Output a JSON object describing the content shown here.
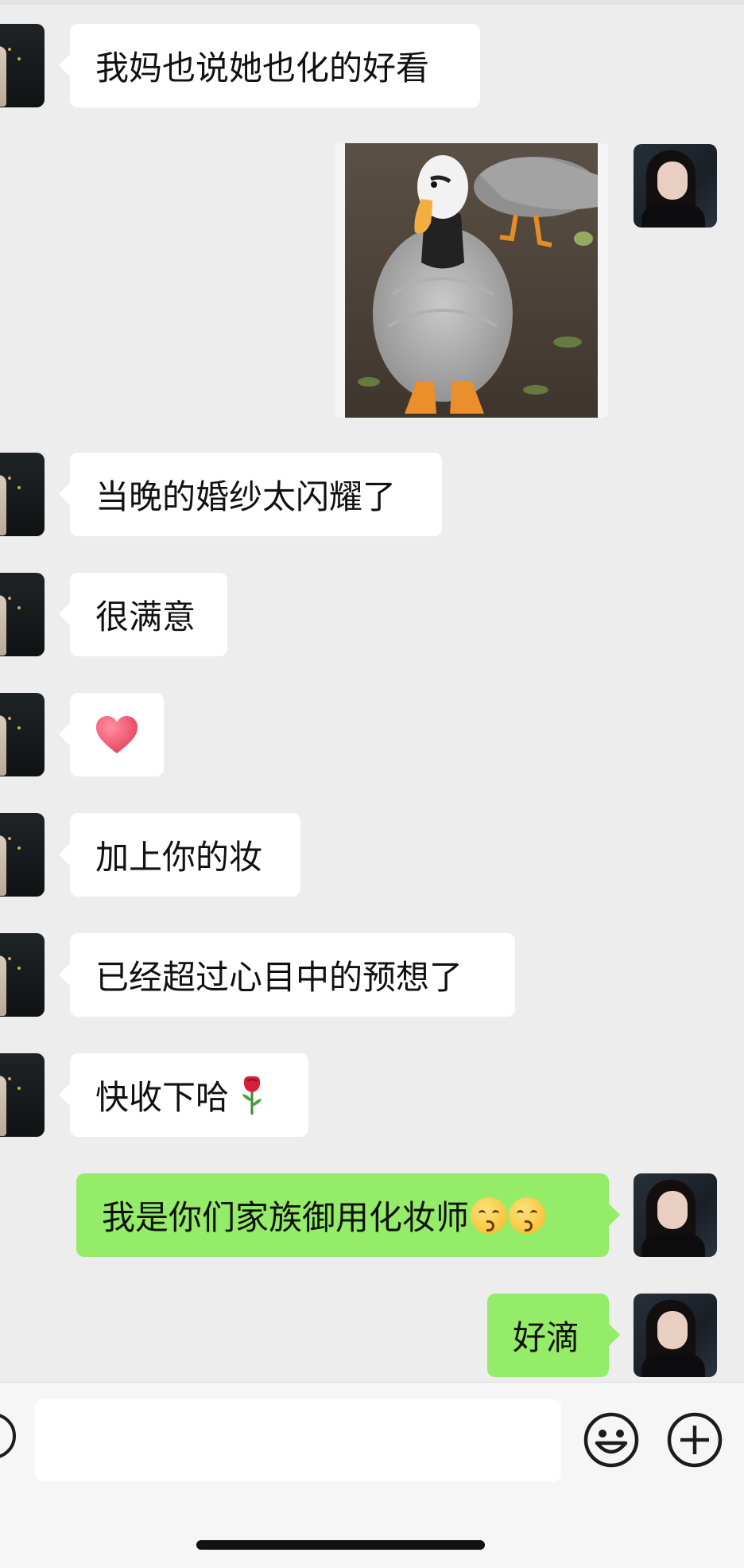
{
  "messages": [
    {
      "side": "in",
      "text": "我妈也说她也化的好看"
    },
    {
      "side": "out",
      "type": "image",
      "icon": "goose-photo"
    },
    {
      "side": "in",
      "text": "当晚的婚纱太闪耀了"
    },
    {
      "side": "in",
      "text": "很满意"
    },
    {
      "side": "in",
      "type": "emoji",
      "icon": "red-heart-emoji"
    },
    {
      "side": "in",
      "text": "加上你的妆"
    },
    {
      "side": "in",
      "text": "已经超过心目中的预想了"
    },
    {
      "side": "in",
      "text": "快收下哈",
      "icon": "rose-emoji"
    },
    {
      "side": "out",
      "text": "我是你们家族御用化妆师",
      "icon": "kissing-face-emoji"
    },
    {
      "side": "out",
      "text": "好滴"
    }
  ],
  "input_bar": {
    "placeholder": "",
    "icons": [
      "voice-icon",
      "emoji-icon",
      "plus-icon"
    ]
  },
  "colors": {
    "background": "#ededed",
    "incoming_bubble": "#ffffff",
    "outgoing_bubble": "#95ec69"
  }
}
